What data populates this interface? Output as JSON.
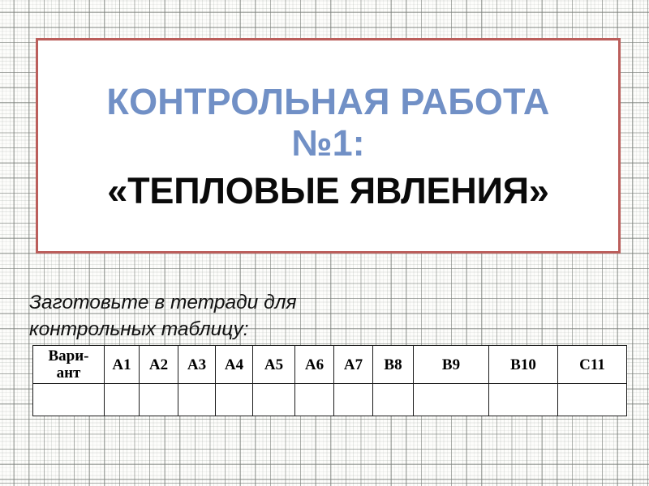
{
  "slide": {
    "background": "graph-paper",
    "background_colors": {
      "paper": "#fdfdfb",
      "major_line": "#787c78",
      "minor_line": "#8c968c"
    }
  },
  "title_card": {
    "border_color": "#bb5e5b",
    "accent_color": "#7190c6",
    "line1": "КОНТРОЛЬНАЯ РАБОТА",
    "line2": "№1:",
    "line3": "«ТЕПЛОВЫЕ ЯВЛЕНИЯ»"
  },
  "instruction": {
    "text": "Заготовьте в тетради для контрольных таблицу:"
  },
  "table": {
    "headers": [
      "Вари-",
      "ант",
      "A1",
      "A2",
      "A3",
      "A4",
      "A5",
      "A6",
      "A7",
      "B8",
      "B9",
      "B10",
      "C11"
    ],
    "variant_header_line1": "Вари-",
    "variant_header_line2": "ант",
    "column_labels": [
      "A1",
      "A2",
      "A3",
      "A4",
      "A5",
      "A6",
      "A7",
      "B8",
      "B9",
      "B10",
      "C11"
    ],
    "answer_row": [
      "",
      "",
      "",
      "",
      "",
      "",
      "",
      "",
      "",
      "",
      "",
      ""
    ],
    "border_color": "#1a1a1a"
  }
}
